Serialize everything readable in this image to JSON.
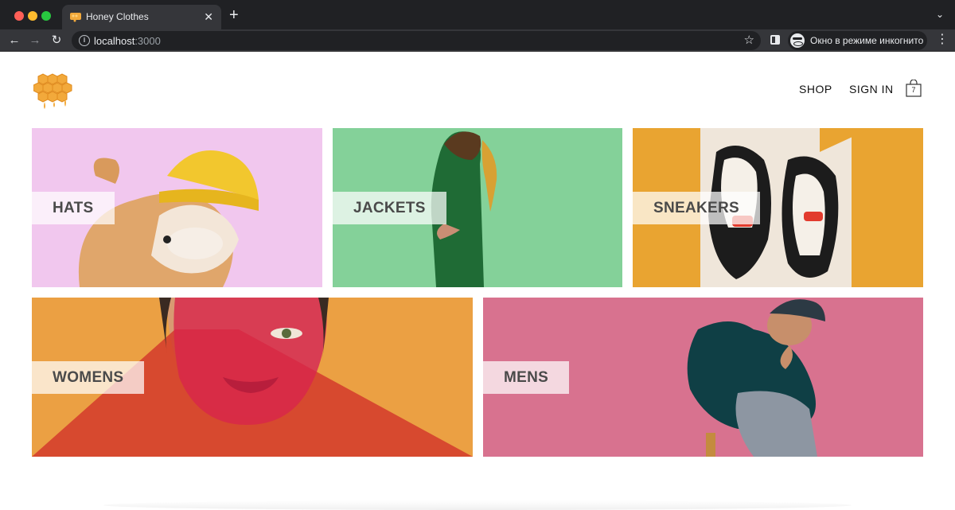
{
  "browser": {
    "tab_title": "Honey Clothes",
    "tab_close": "✕",
    "new_tab": "+",
    "tab_menu": "⌄",
    "nav_back": "←",
    "nav_forward": "→",
    "nav_reload": "↻",
    "url_host": "localhost",
    "url_port": ":3000",
    "bookmark_star": "☆",
    "incognito_label": "Окно в режиме инкогнито",
    "menu": "⋮"
  },
  "header": {
    "logo": "honeycomb-logo-icon",
    "nav": {
      "shop": "SHOP",
      "sign_in": "SIGN IN"
    },
    "cart": {
      "icon": "shopping-bag-icon",
      "count": "7"
    }
  },
  "categories": [
    {
      "id": "hats",
      "label": "HATS",
      "bg_color": "#f1c7ee"
    },
    {
      "id": "jackets",
      "label": "JACKETS",
      "bg_color": "#7fcf95"
    },
    {
      "id": "sneakers",
      "label": "SNEAKERS",
      "bg_color": "#e9a431"
    },
    {
      "id": "womens",
      "label": "WOMENS",
      "bg_color": "#eba043"
    },
    {
      "id": "mens",
      "label": "MENS",
      "bg_color": "#d8728f"
    }
  ],
  "colors": {
    "chrome_dark": "#202124",
    "chrome_mid": "#35363a",
    "honey": "#f2a93b"
  }
}
